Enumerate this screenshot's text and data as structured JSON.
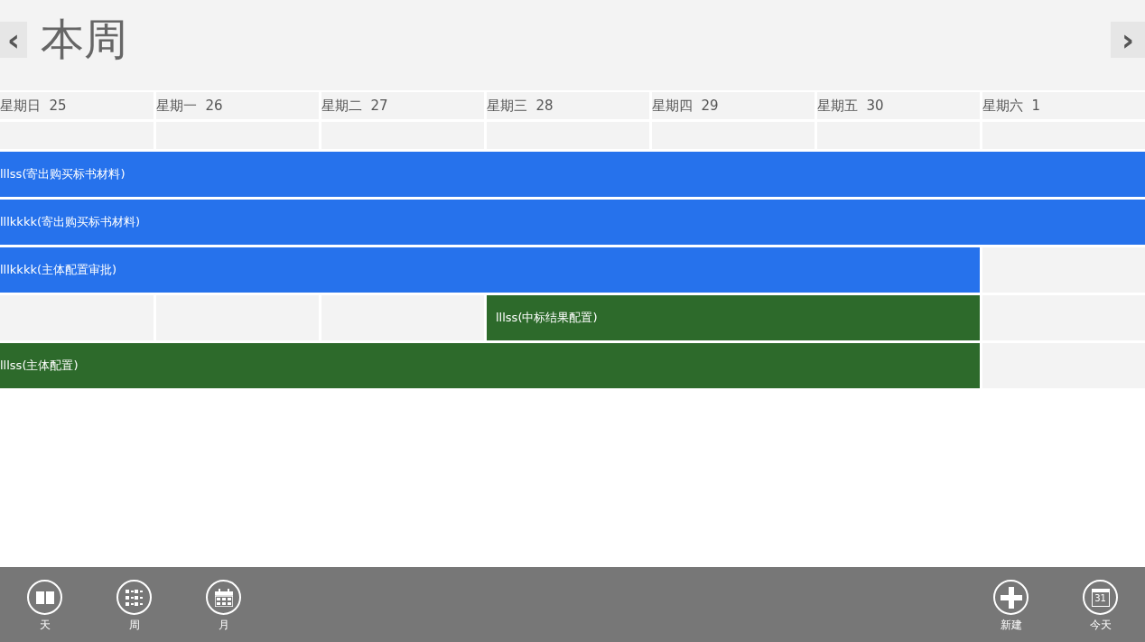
{
  "header": {
    "title": "本周",
    "prev_button": "‹",
    "next_button": "›"
  },
  "days": [
    {
      "name": "星期日",
      "date": "25"
    },
    {
      "name": "星期一",
      "date": "26"
    },
    {
      "name": "星期二",
      "date": "27"
    },
    {
      "name": "星期三",
      "date": "28"
    },
    {
      "name": "星期四",
      "date": "29"
    },
    {
      "name": "星期五",
      "date": "30"
    },
    {
      "name": "星期六",
      "date": "1"
    }
  ],
  "events": [
    {
      "title": "lllss(寄出购买标书材料)",
      "color": "#2672ec",
      "days": [
        true,
        true,
        true,
        true,
        true,
        true,
        true
      ]
    },
    {
      "title": "lllkkkk(寄出购买标书材料)",
      "color": "#2672ec",
      "days": [
        true,
        true,
        true,
        true,
        true,
        true,
        true
      ]
    },
    {
      "title": "lllkkkk(主体配置审批)",
      "color": "#2672ec",
      "days": [
        true,
        true,
        true,
        true,
        true,
        true,
        false
      ]
    },
    {
      "title": "lllss(中标结果配置)",
      "color": "#2d6a2b",
      "days": [
        false,
        false,
        false,
        true,
        true,
        true,
        false
      ]
    },
    {
      "title": "lllss(主体配置)",
      "color": "#2d6a2b",
      "days": [
        true,
        true,
        true,
        true,
        true,
        true,
        false
      ]
    }
  ],
  "app_bar": {
    "left": [
      {
        "kind": "day",
        "label": "天"
      },
      {
        "kind": "week",
        "label": "周"
      },
      {
        "kind": "month",
        "label": "月"
      }
    ],
    "right": [
      {
        "kind": "new",
        "label": "新建"
      },
      {
        "kind": "today",
        "label": "今天",
        "icon_text": "31"
      }
    ]
  }
}
